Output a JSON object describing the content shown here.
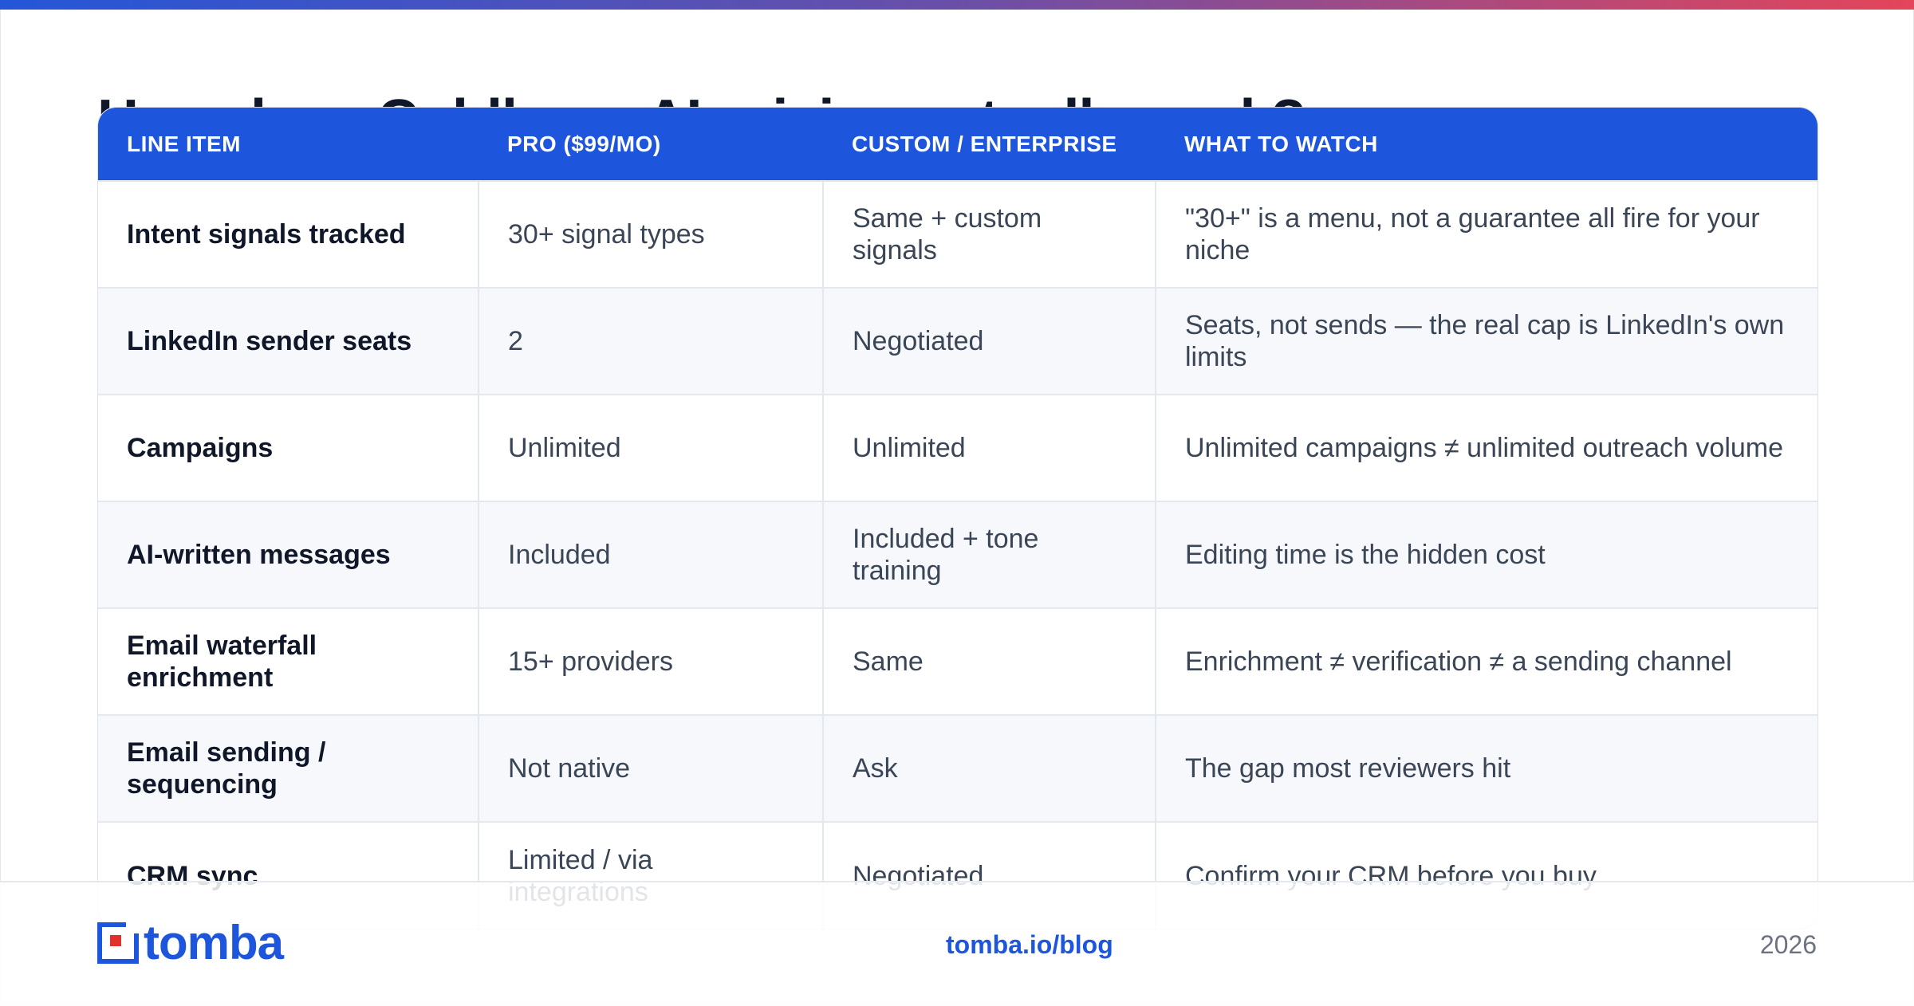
{
  "page": {
    "title": "How does Coldbrew AI pricing actually work?"
  },
  "table": {
    "headers": [
      "LINE ITEM",
      "PRO ($99/MO)",
      "CUSTOM / ENTERPRISE",
      "WHAT TO WATCH"
    ],
    "rows": [
      [
        "Intent signals tracked",
        "30+ signal types",
        "Same + custom signals",
        "\"30+\" is a menu, not a guarantee all fire for your niche"
      ],
      [
        "LinkedIn sender seats",
        "2",
        "Negotiated",
        "Seats, not sends — the real cap is LinkedIn's own limits"
      ],
      [
        "Campaigns",
        "Unlimited",
        "Unlimited",
        "Unlimited campaigns ≠ unlimited outreach volume"
      ],
      [
        "AI-written messages",
        "Included",
        "Included + tone training",
        "Editing time is the hidden cost"
      ],
      [
        "Email waterfall enrichment",
        "15+ providers",
        "Same",
        "Enrichment ≠ verification ≠ a sending channel"
      ],
      [
        "Email sending / sequencing",
        "Not native",
        "Ask",
        "The gap most reviewers hit"
      ],
      [
        "CRM sync",
        "Limited / via integrations",
        "Negotiated",
        "Confirm your CRM before you buy"
      ]
    ]
  },
  "footer": {
    "logo_text": "tomba",
    "logo_icon": "tomba-logo-icon",
    "link": "tomba.io/blog",
    "year": "2026"
  },
  "colors": {
    "brand_blue": "#1d55dc",
    "gradient_start": "#2456d8",
    "gradient_end": "#e4455a",
    "logo_red": "#e0322c"
  }
}
